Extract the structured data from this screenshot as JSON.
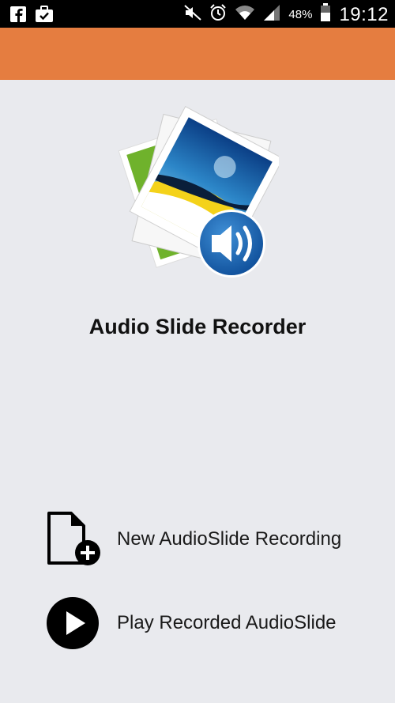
{
  "status_bar": {
    "battery_percent": "48%",
    "time": "19:12",
    "icons": [
      "facebook-icon",
      "briefcase-check-icon",
      "mute-icon",
      "alarm-icon",
      "wifi-icon",
      "signal-icon",
      "battery-icon"
    ]
  },
  "app": {
    "title": "Audio Slide Recorder",
    "accent_color": "#e57d40",
    "logo_icon": "photo-stack-with-speaker-icon"
  },
  "menu": {
    "items": [
      {
        "label": "New AudioSlide Recording",
        "icon": "new-file-plus-icon"
      },
      {
        "label": "Play Recorded AudioSlide",
        "icon": "play-circle-icon"
      }
    ]
  }
}
